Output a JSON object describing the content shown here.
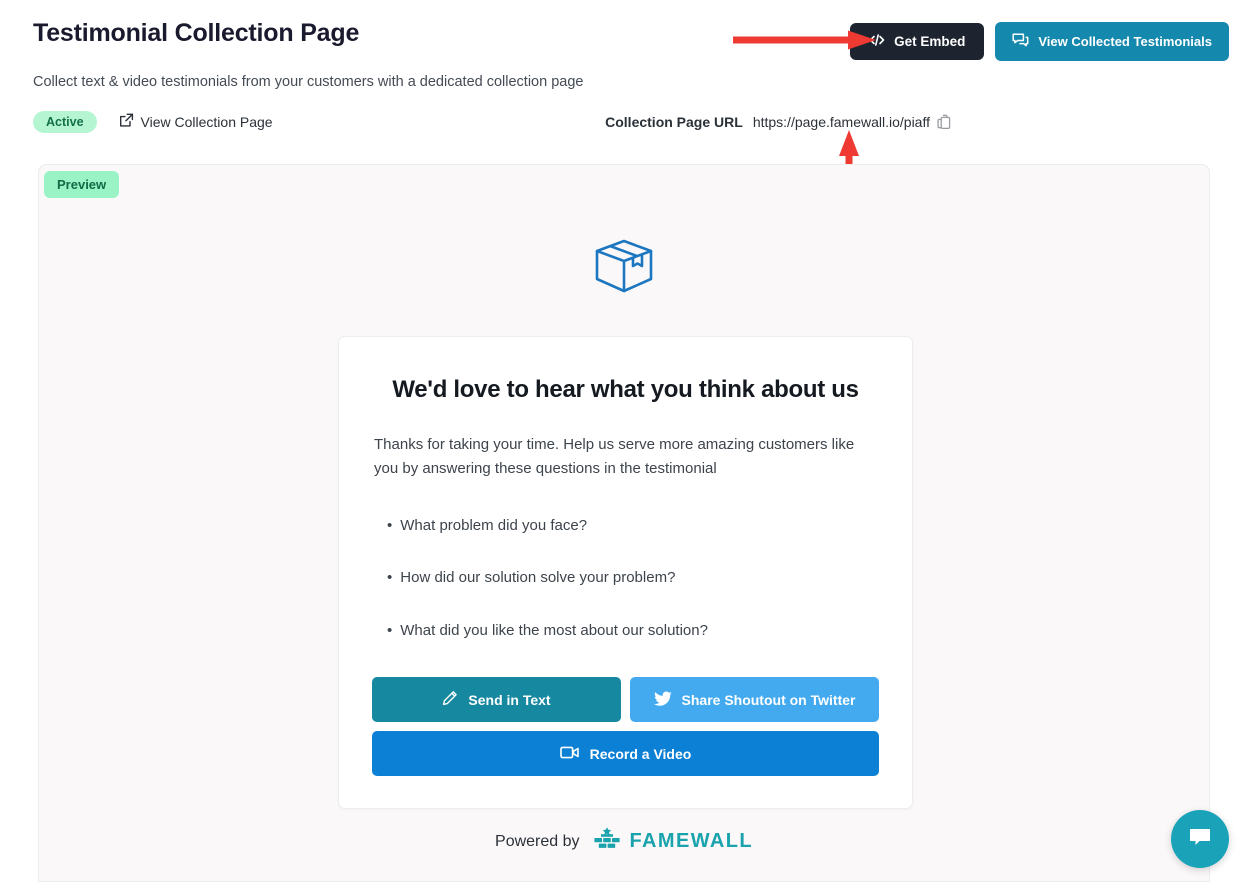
{
  "header": {
    "title": "Testimonial Collection Page",
    "subtitle": "Collect text & video testimonials from your customers with a dedicated collection page",
    "get_embed_label": "Get Embed",
    "view_testimonials_label": "View Collected Testimonials"
  },
  "status": {
    "badge": "Active",
    "view_collection_page": "View Collection Page",
    "url_label": "Collection Page URL",
    "url_value": "https://page.famewall.io/piaff"
  },
  "preview": {
    "badge": "Preview",
    "card": {
      "heading": "We'd love to hear what you think about us",
      "description": "Thanks for taking your time. Help us serve more amazing customers like you by answering these questions in the testimonial",
      "bullet": "•",
      "questions": [
        "What problem did you face?",
        "How did our solution solve your problem?",
        "What did you like the most about our solution?"
      ],
      "buttons": {
        "send_text": "Send in Text",
        "twitter": "Share Shoutout on Twitter",
        "record_video": "Record a Video"
      }
    },
    "footer": {
      "powered_by": "Powered by",
      "brand": "FAMEWALL"
    }
  },
  "colors": {
    "embed_button": "#1d2430",
    "view_testimonials_button": "#1588ad",
    "active_badge_bg": "#b6f5d2",
    "preview_badge_bg": "#9af3c5",
    "send_text_button": "#16889f",
    "twitter_button": "#43aaf0",
    "record_video_button": "#0b80d4",
    "brand": "#1aa3ac",
    "annotation_arrow": "#ee3a33",
    "chat_widget": "#1aa3b8"
  }
}
